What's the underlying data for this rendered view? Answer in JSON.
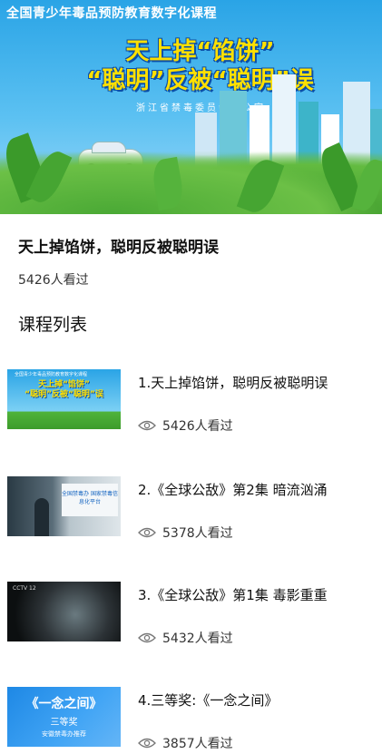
{
  "banner": {
    "top_text": "全国青少年毒品预防教育数字化课程",
    "headline_1": "天上掉“馅饼”",
    "headline_2": "“聪明”反被“聪明”误",
    "org": "浙江省禁毒委员会办公室"
  },
  "course": {
    "title": "天上掉馅饼，聪明反被聪明误",
    "views": "5426人看过"
  },
  "section_title": "课程列表",
  "list": [
    {
      "title": "1.天上掉馅饼，聪明反被聪明误",
      "views": "5426人看过",
      "thumb": {
        "top": "全国青少年毒品预防教育数字化课程",
        "line1": "天上掉“馅饼”",
        "line2": "“聪明”反被“聪明”误"
      }
    },
    {
      "title": "2.《全球公敌》第2集 暗流汹涌",
      "views": "5378人看过",
      "thumb": {
        "screen": "全国禁毒办 国家禁毒信息化平台"
      }
    },
    {
      "title": "3.《全球公敌》第1集 毒影重重",
      "views": "5432人看过",
      "thumb": {
        "logo": "CCTV 12"
      }
    },
    {
      "title": "4.三等奖:《一念之间》",
      "views": "3857人看过",
      "thumb": {
        "title": "《一念之间》",
        "prize": "三等奖",
        "note": "安徽禁毒办推荐"
      }
    }
  ],
  "icons": {
    "views": "eye-icon"
  },
  "colors": {
    "banner_blue": "#2aa4e6",
    "headline_yellow": "#ffe000",
    "grass_green": "#4aa935"
  }
}
